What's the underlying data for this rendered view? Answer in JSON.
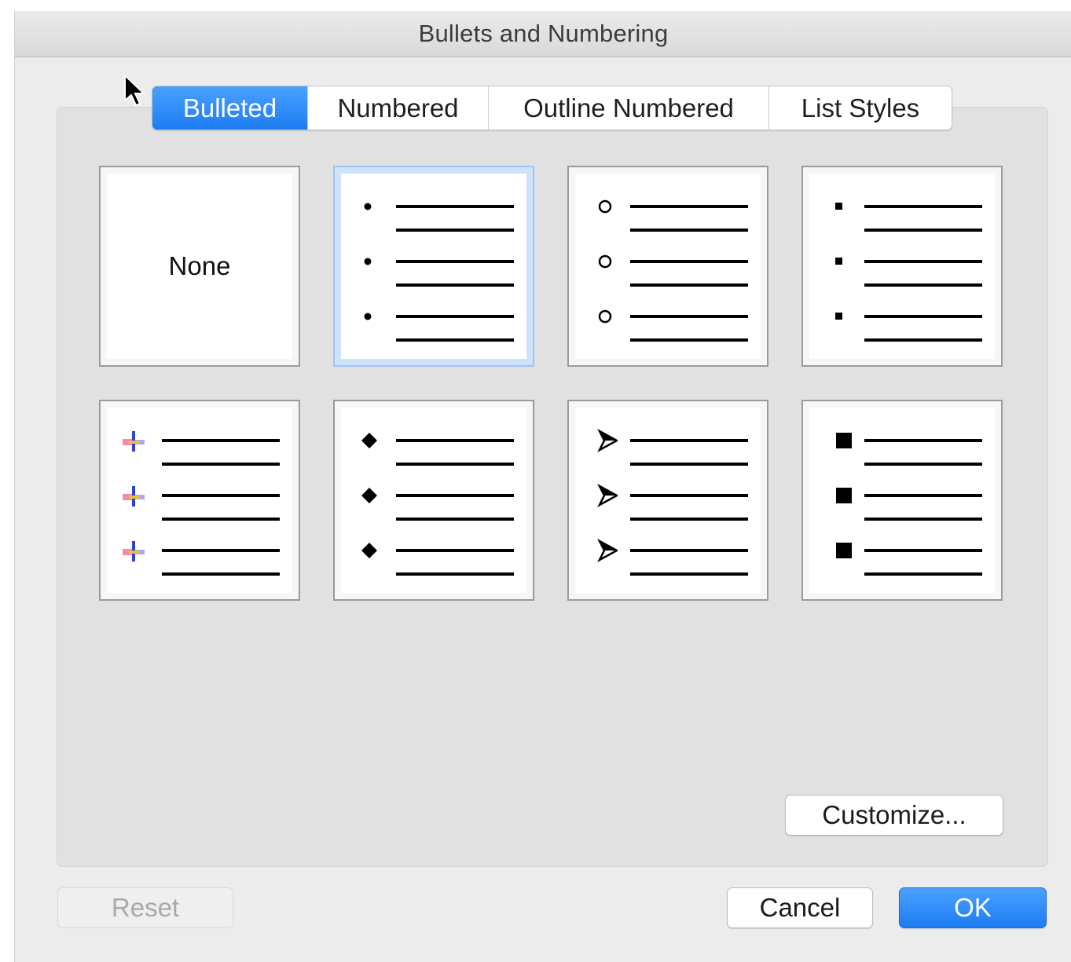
{
  "window": {
    "title": "Bullets and Numbering"
  },
  "tabs": [
    {
      "label": "Bulleted",
      "active": true
    },
    {
      "label": "Numbered",
      "active": false
    },
    {
      "label": "Outline Numbered",
      "active": false
    },
    {
      "label": "List Styles",
      "active": false
    }
  ],
  "gallery": {
    "none_label": "None",
    "selected_index": 1,
    "tiles": [
      {
        "bullet_icon": "none"
      },
      {
        "bullet_icon": "small-dot-icon"
      },
      {
        "bullet_icon": "hollow-circle-icon"
      },
      {
        "bullet_icon": "small-square-icon"
      },
      {
        "bullet_icon": "color-cross-icon"
      },
      {
        "bullet_icon": "four-diamond-icon"
      },
      {
        "bullet_icon": "arrowhead-icon"
      },
      {
        "bullet_icon": "large-square-icon"
      }
    ]
  },
  "buttons": {
    "customize": "Customize...",
    "reset": "Reset",
    "cancel": "Cancel",
    "ok": "OK"
  },
  "colors": {
    "accent": "#1d7cf2",
    "selected_tile": "#9dc4f5"
  }
}
